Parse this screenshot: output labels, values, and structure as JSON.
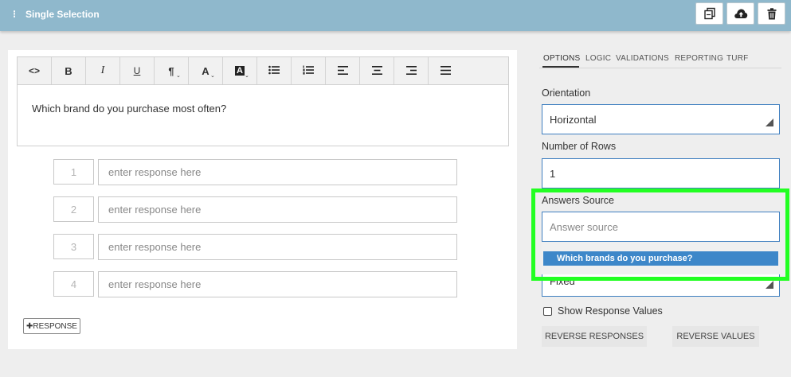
{
  "header": {
    "menu_glyph": "⁝",
    "title": "Single Selection",
    "buttons": [
      {
        "icon": "copy-icon"
      },
      {
        "icon": "cloud-upload-icon"
      },
      {
        "icon": "trash-icon"
      }
    ]
  },
  "toolbar": {
    "code": "<>",
    "bold": "B",
    "italic": "I",
    "underline": "U",
    "paragraph": "¶",
    "font_color": "A",
    "bg_color": "A",
    "caret": "⌄",
    "icons": [
      "code-icon",
      "bold-icon",
      "italic-icon",
      "underline-icon",
      "paragraph-icon",
      "font-color-icon",
      "background-color-icon",
      "bullet-list-icon",
      "numbered-list-icon",
      "align-left-icon",
      "align-center-icon",
      "align-right-icon",
      "justify-icon"
    ]
  },
  "editor": {
    "question": "Which brand do you purchase most often?"
  },
  "responses": [
    {
      "number": "1",
      "placeholder": "enter response here"
    },
    {
      "number": "2",
      "placeholder": "enter response here"
    },
    {
      "number": "3",
      "placeholder": "enter response here"
    },
    {
      "number": "4",
      "placeholder": "enter response here"
    }
  ],
  "add_response_label": "✚RESPONSE",
  "tabs": [
    "OPTIONS",
    "LOGIC",
    "VALIDATIONS",
    "REPORTING",
    "TURF"
  ],
  "active_tab": "OPTIONS",
  "options": {
    "orientation_label": "Orientation",
    "orientation_value": "Horizontal",
    "rows_label": "Number of Rows",
    "rows_value": "1",
    "answers_source_label": "Answers Source",
    "answers_source_placeholder": "Answer source",
    "answers_source_suggestion": "Which brands do you purchase?",
    "hidden_field_value": "Fixed",
    "show_values_label": "Show Response Values",
    "reverse_responses": "REVERSE RESPONSES",
    "reverse_values": "REVERSE VALUES"
  },
  "colors": {
    "header_bg": "#8fb8cc",
    "field_border": "#3f7fc0",
    "suggestion_bg": "#3d87c9",
    "highlight": "#22ff22"
  }
}
